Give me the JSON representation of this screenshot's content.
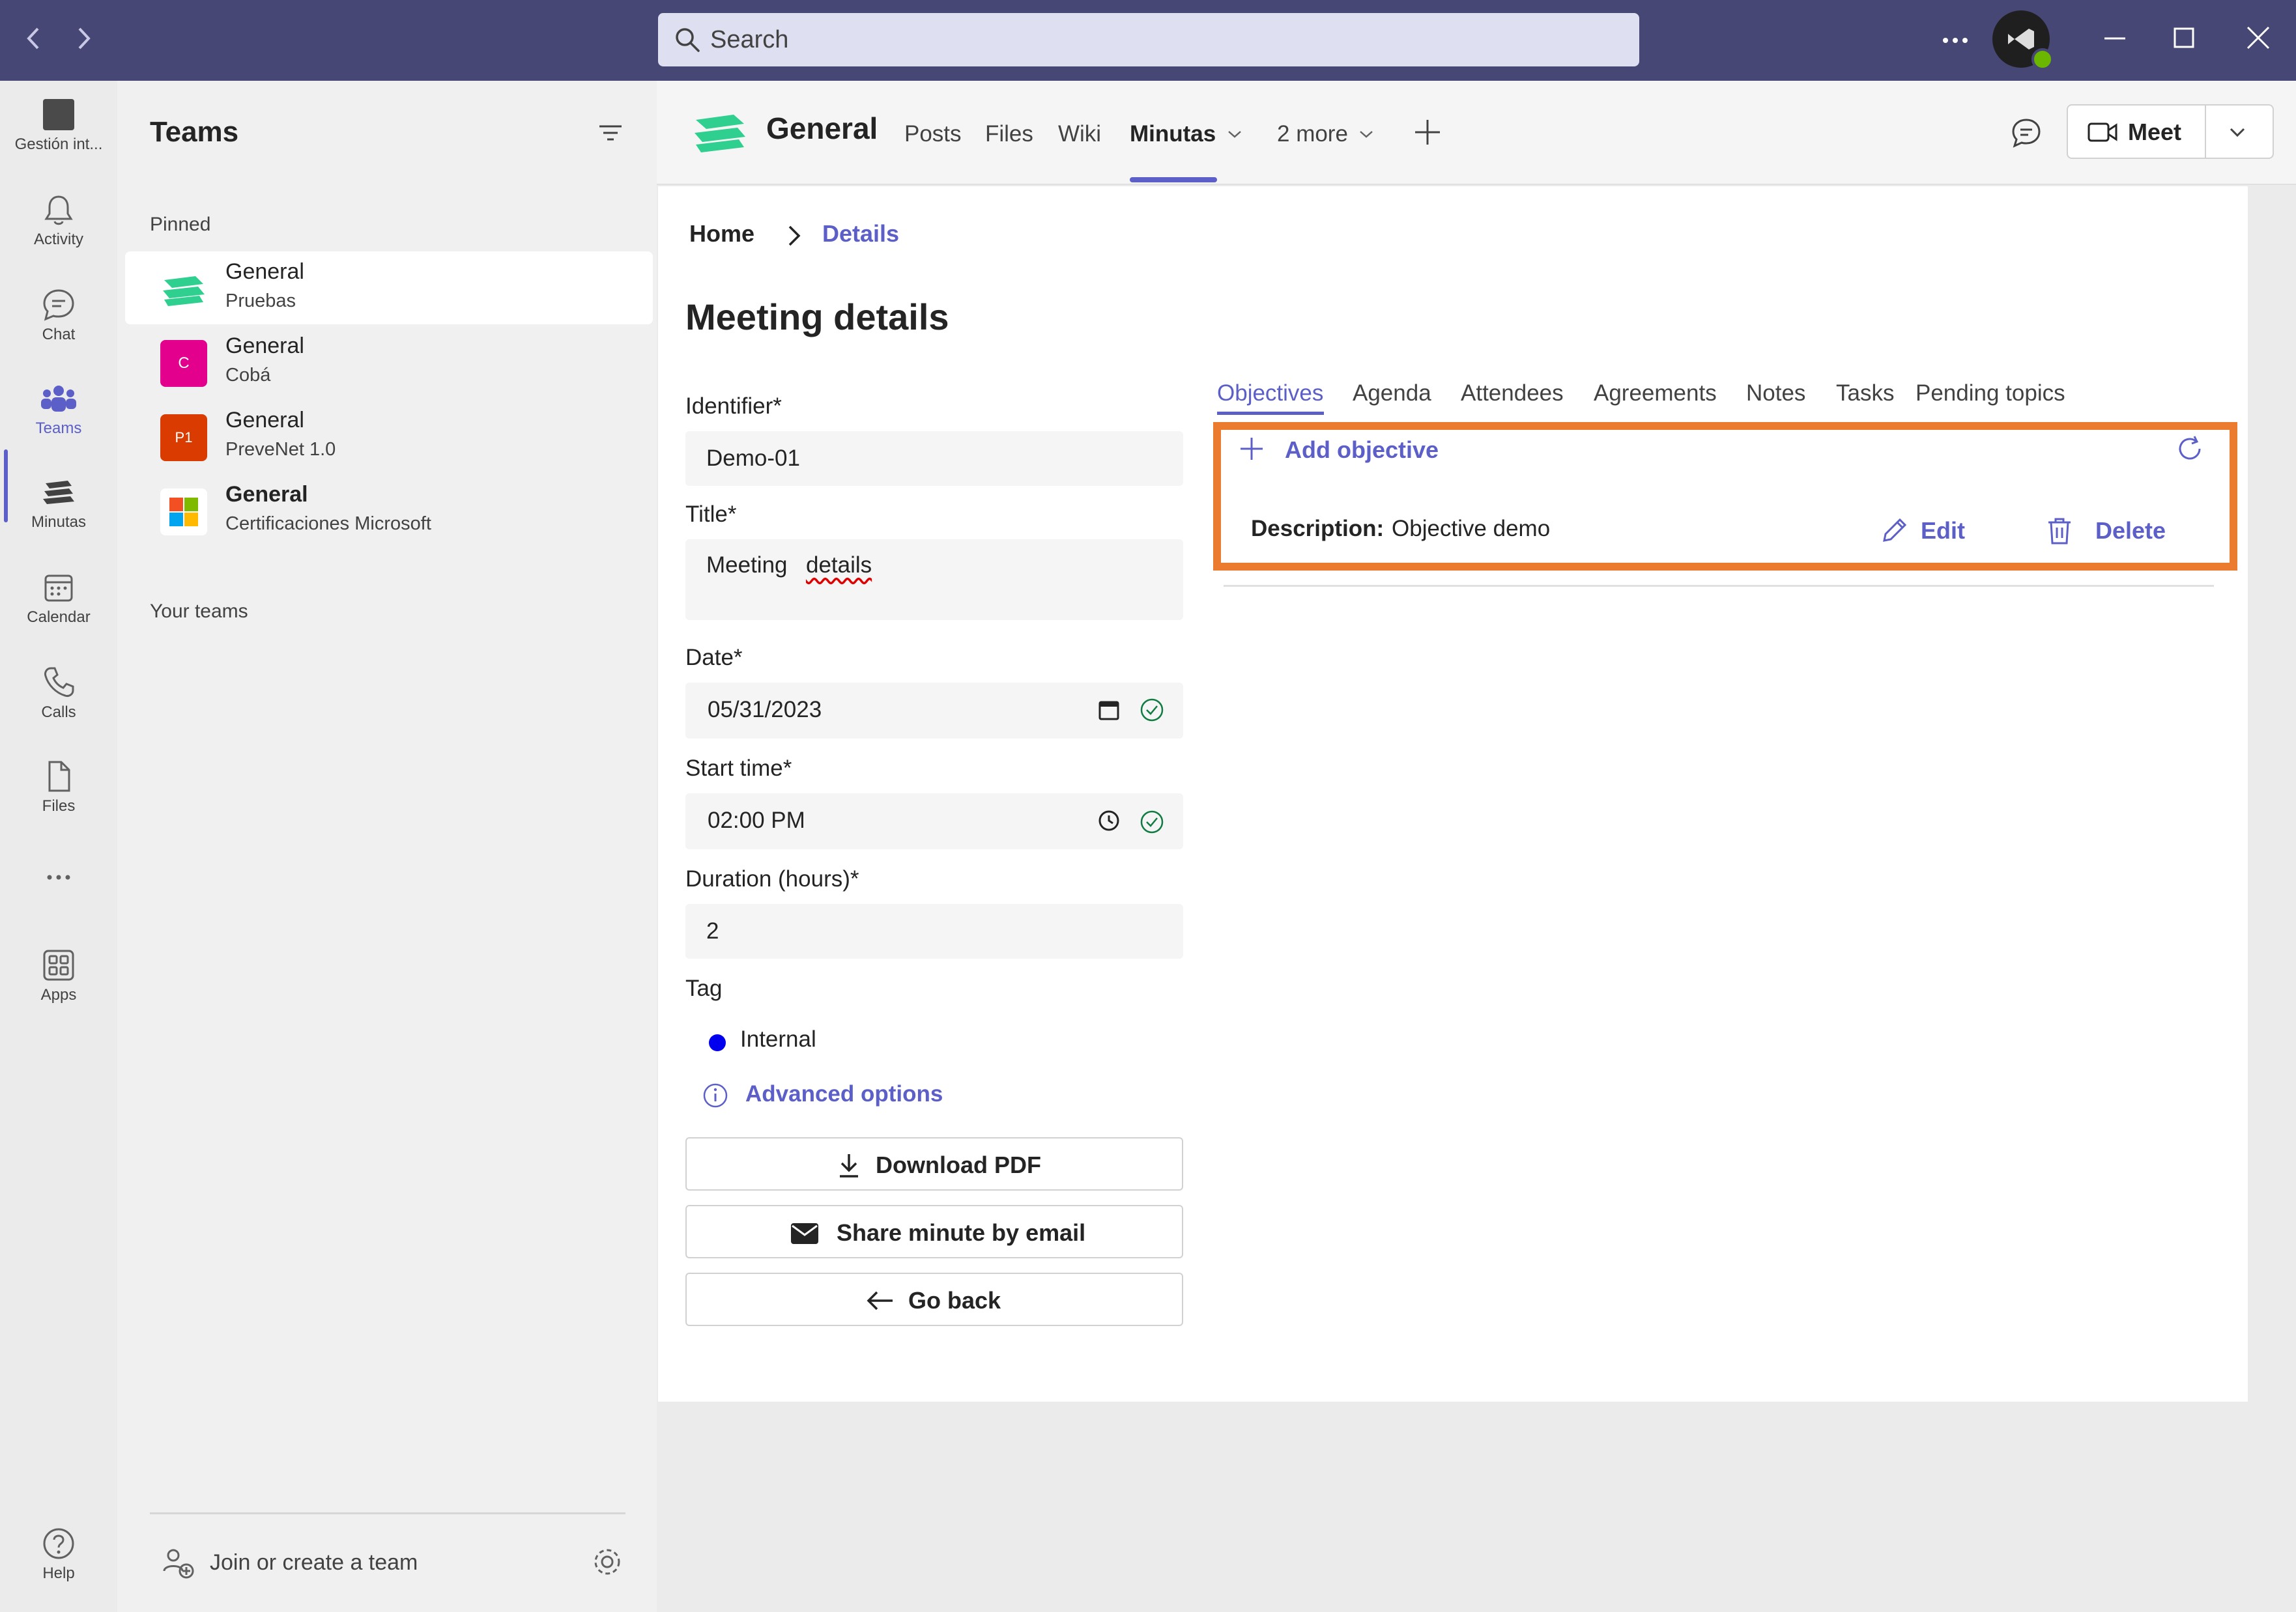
{
  "search": {
    "placeholder": "Search"
  },
  "rail": {
    "items": [
      {
        "label": "Gestión int..."
      },
      {
        "label": "Activity"
      },
      {
        "label": "Chat"
      },
      {
        "label": "Teams"
      },
      {
        "label": "Minutas"
      },
      {
        "label": "Calendar"
      },
      {
        "label": "Calls"
      },
      {
        "label": "Files"
      },
      {
        "label": "Apps"
      },
      {
        "label": "Help"
      }
    ]
  },
  "teams_pane": {
    "title": "Teams",
    "pinned_label": "Pinned",
    "your_teams_label": "Your teams",
    "pinned": [
      {
        "name": "General",
        "team": "Pruebas"
      },
      {
        "name": "General",
        "team": "Cobá",
        "initials": "C",
        "color": "#e3008c"
      },
      {
        "name": "General",
        "team": "PreveNet 1.0",
        "initials": "P1",
        "color": "#da3b01"
      },
      {
        "name": "General",
        "team": "Certificaciones Microsoft"
      }
    ],
    "join_label": "Join or create a team"
  },
  "channel": {
    "title": "General",
    "tabs": [
      "Posts",
      "Files",
      "Wiki",
      "Minutas",
      "2 more"
    ],
    "meet_label": "Meet"
  },
  "breadcrumb": {
    "home": "Home",
    "current": "Details"
  },
  "page_title": "Meeting details",
  "form": {
    "identifier_label": "Identifier*",
    "identifier_value": "Demo-01",
    "title_label": "Title*",
    "title_value_a": "Meeting",
    "title_value_b": "details",
    "date_label": "Date*",
    "date_value": "05/31/2023",
    "start_label": "Start time*",
    "start_value": "02:00 PM",
    "duration_label": "Duration (hours)*",
    "duration_value": "2",
    "tag_label": "Tag",
    "tag_value": "Internal",
    "tag_color": "#0000ee",
    "advanced_label": "Advanced options"
  },
  "buttons": {
    "download_pdf": "Download PDF",
    "share_email": "Share minute by email",
    "go_back": "Go back"
  },
  "detail_tabs": [
    "Objectives",
    "Agenda",
    "Attendees",
    "Agreements",
    "Notes",
    "Tasks",
    "Pending topics"
  ],
  "objectives": {
    "add_label": "Add objective",
    "items": [
      {
        "desc_label": "Description:",
        "desc_value": "Objective demo",
        "edit_label": "Edit",
        "delete_label": "Delete"
      }
    ]
  },
  "colors": {
    "accent": "#5b5fc7",
    "titlebar": "#464775",
    "highlight": "#ea7b2f"
  }
}
